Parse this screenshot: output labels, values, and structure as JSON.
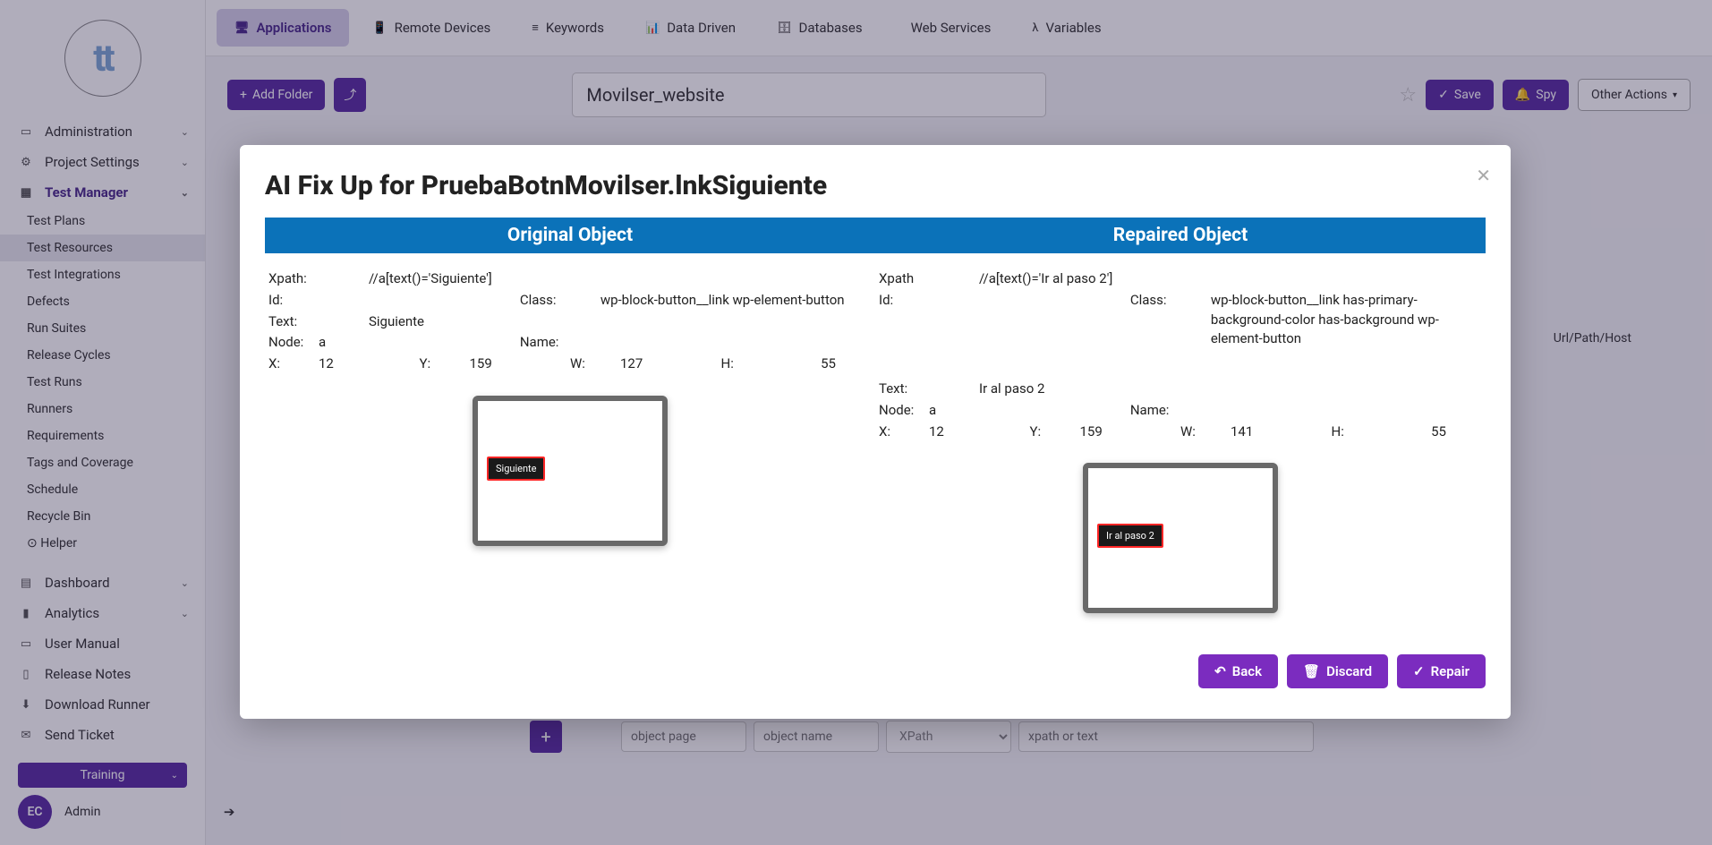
{
  "sidebar": {
    "logo_text": "tt",
    "groups": [
      {
        "label": "Administration",
        "icon": "▭"
      },
      {
        "label": "Project Settings",
        "icon": "⚙"
      },
      {
        "label": "Test Manager",
        "icon": "▦",
        "expanded": true
      }
    ],
    "sub_items": [
      "Test Plans",
      "Test Resources",
      "Test Integrations",
      "Defects",
      "Run Suites",
      "Release Cycles",
      "Test Runs",
      "Runners",
      "Requirements",
      "Tags and Coverage",
      "Schedule",
      "Recycle Bin",
      "⊙ Helper"
    ],
    "sub_active_index": 1,
    "bottom": [
      {
        "label": "Dashboard",
        "icon": "▤"
      },
      {
        "label": "Analytics",
        "icon": "▮"
      },
      {
        "label": "User Manual",
        "icon": "▭"
      },
      {
        "label": "Release Notes",
        "icon": "▯"
      },
      {
        "label": "Download Runner",
        "icon": "⬇"
      },
      {
        "label": "Send Ticket",
        "icon": "✉"
      }
    ],
    "env": "Training",
    "user_initials": "EC",
    "user_role": "Admin"
  },
  "tabs": [
    {
      "label": "Applications",
      "icon": "🖥"
    },
    {
      "label": "Remote Devices",
      "icon": "📱"
    },
    {
      "label": "Keywords",
      "icon": "≡"
    },
    {
      "label": "Data Driven",
      "icon": "📊"
    },
    {
      "label": "Databases",
      "icon": "🗄"
    },
    {
      "label": "Web Services",
      "icon": "</>"
    },
    {
      "label": "Variables",
      "icon": "λ"
    }
  ],
  "toolbar": {
    "add_folder": "Add Folder",
    "title_value": "Movilser_website",
    "save": "Save",
    "spy": "Spy",
    "other": "Other Actions"
  },
  "table_headers": {
    "url": "Url/Path/Host"
  },
  "modal": {
    "title": "AI Fix Up for PruebaBotnMovilser.lnkSiguiente",
    "header_left": "Original Object",
    "header_right": "Repaired Object",
    "original": {
      "xpath": "//a[text()='Siguiente']",
      "id": "",
      "class": "wp-block-button__link wp-element-button",
      "text": "Siguiente",
      "node": "a",
      "x": "12",
      "y": "159",
      "w": "127",
      "h": "55",
      "preview_text": "Siguiente"
    },
    "repaired": {
      "xpath": "//a[text()='Ir al paso 2']",
      "id": "",
      "class": "wp-block-button__link has-primary-background-color has-background wp-element-button",
      "text": "Ir al paso 2",
      "node": "a",
      "x": "12",
      "y": "159",
      "w": "141",
      "h": "55",
      "preview_text": "Ir al paso 2"
    },
    "labels": {
      "xpath": "Xpath:",
      "xpath2": "Xpath",
      "id": "Id:",
      "class": "Class:",
      "name": "Name:",
      "text": "Text:",
      "node": "Node:",
      "x": "X:",
      "y": "Y:",
      "w": "W:",
      "h": "H:"
    },
    "actions": {
      "back": "Back",
      "discard": "Discard",
      "repair": "Repair"
    }
  },
  "bottom_form": {
    "page_ph": "object page",
    "name_ph": "object name",
    "type_value": "XPath",
    "xpath_ph": "xpath or text"
  }
}
